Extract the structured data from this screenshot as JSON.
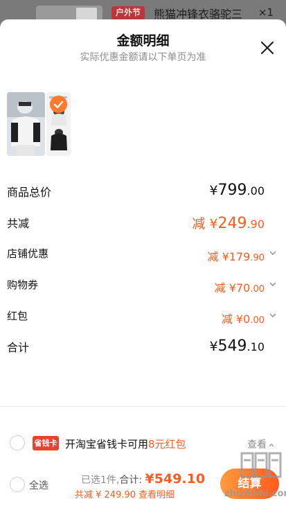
{
  "background_bar": {
    "badge": "户外节",
    "title": "熊猫冲锋衣骆驼三",
    "qty": "×1"
  },
  "sheet": {
    "title": "金额明细",
    "subtitle": "实际优惠金额请以下单页为准",
    "close_icon": "close-icon"
  },
  "rows": {
    "total_goods": {
      "label": "商品总价",
      "prefix": "¥",
      "int": "799",
      "dec": ".00"
    },
    "total_discount": {
      "label": "共减",
      "prefix": "减 ¥",
      "int": "249",
      "dec": ".90"
    },
    "store_discount": {
      "label": "店铺优惠",
      "prefix": "减 ¥",
      "int": "179",
      "dec": ".90"
    },
    "coupon": {
      "label": "购物券",
      "prefix": "减 ¥",
      "int": "70",
      "dec": ".00"
    },
    "red_packet": {
      "label": "红包",
      "prefix": "减 ¥",
      "int": "0",
      "dec": ".00"
    },
    "subtotal": {
      "label": "合计",
      "prefix": "¥",
      "int": "549",
      "dec": ".10"
    }
  },
  "bottom": {
    "card_logo": "省钱卡",
    "card_text_pre": "开淘宝省钱卡可用",
    "card_text_highlight": "8元红包",
    "view_label": "查看",
    "select_all": "全选",
    "selected_text": "已选1件,",
    "total_label": "合计: ",
    "total_price": "¥549.10",
    "discount_summary": "共减 ¥ 249.90  查看明细",
    "checkout": "结算"
  },
  "watermark": "zhizhizhi.com",
  "colors": {
    "accent": "#ff5a1f",
    "text": "#111111",
    "muted": "#8c8c8c"
  }
}
